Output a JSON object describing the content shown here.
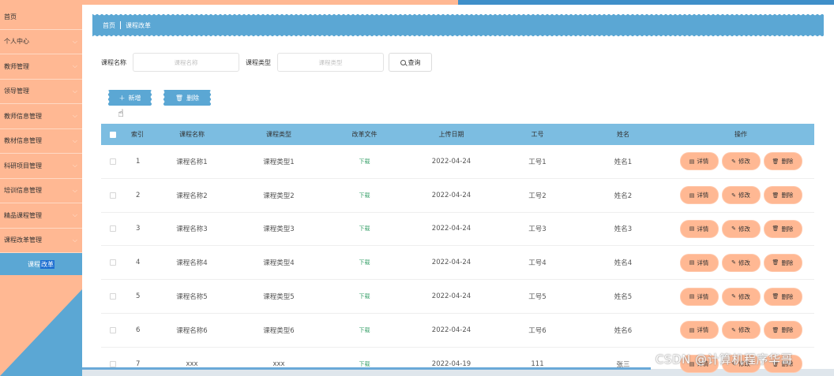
{
  "sidebar": {
    "items": [
      {
        "label": "首页",
        "expand": false
      },
      {
        "label": "个人中心",
        "expand": true
      },
      {
        "label": "教师管理",
        "expand": true
      },
      {
        "label": "领导管理",
        "expand": true
      },
      {
        "label": "教师信息管理",
        "expand": true
      },
      {
        "label": "教材信息管理",
        "expand": true
      },
      {
        "label": "科研项目管理",
        "expand": true
      },
      {
        "label": "培训信息管理",
        "expand": true
      },
      {
        "label": "精品课程管理",
        "expand": true
      },
      {
        "label": "课程改革管理",
        "expand": true
      }
    ],
    "submenu": {
      "part1": "课程",
      "part2": "改革"
    }
  },
  "breadcrumb": {
    "home": "首页",
    "current": "课程改革"
  },
  "search": {
    "name_label": "课程名称",
    "name_placeholder": "课程名称",
    "type_label": "课程类型",
    "type_placeholder": "课程类型",
    "button": "查询"
  },
  "actions": {
    "add": "新增",
    "delete": "删除"
  },
  "table": {
    "headers": {
      "index": "索引",
      "name": "课程名称",
      "type": "课程类型",
      "file": "改革文件",
      "date": "上传日期",
      "no": "工号",
      "person": "姓名",
      "ops": "操作"
    },
    "rows": [
      {
        "index": "1",
        "name": "课程名称1",
        "type": "课程类型1",
        "file": "下载",
        "date": "2022-04-24",
        "no": "工号1",
        "person": "姓名1"
      },
      {
        "index": "2",
        "name": "课程名称2",
        "type": "课程类型2",
        "file": "下载",
        "date": "2022-04-24",
        "no": "工号2",
        "person": "姓名2"
      },
      {
        "index": "3",
        "name": "课程名称3",
        "type": "课程类型3",
        "file": "下载",
        "date": "2022-04-24",
        "no": "工号3",
        "person": "姓名3"
      },
      {
        "index": "4",
        "name": "课程名称4",
        "type": "课程类型4",
        "file": "下载",
        "date": "2022-04-24",
        "no": "工号4",
        "person": "姓名4"
      },
      {
        "index": "5",
        "name": "课程名称5",
        "type": "课程类型5",
        "file": "下载",
        "date": "2022-04-24",
        "no": "工号5",
        "person": "姓名5"
      },
      {
        "index": "6",
        "name": "课程名称6",
        "type": "课程类型6",
        "file": "下载",
        "date": "2022-04-24",
        "no": "工号6",
        "person": "姓名6"
      },
      {
        "index": "7",
        "name": "xxx",
        "type": "xxx",
        "file": "下载",
        "date": "2022-04-19",
        "no": "111",
        "person": "张三"
      }
    ],
    "row_ops": {
      "detail": "详情",
      "edit": "修改",
      "delete": "删除"
    }
  },
  "watermark": "CSDN @计算机程序华哥",
  "colors": {
    "accent_orange": "#ffb893",
    "accent_blue": "#5ba7d4",
    "header_blue": "#7cbde1",
    "link_green": "#3aa16b"
  },
  "icons": {
    "search": "search-icon",
    "add": "plus-icon",
    "delete": "trash-icon",
    "detail": "detail-icon",
    "edit": "pencil-icon",
    "expand": "chevron-down-icon"
  }
}
